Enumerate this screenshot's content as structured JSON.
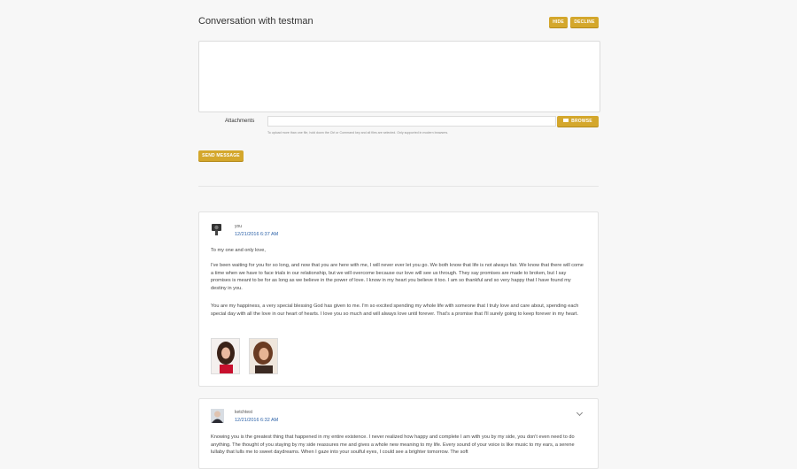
{
  "header": {
    "title": "Conversation with testman",
    "hide_label": "HIDE",
    "decline_label": "DECLINE"
  },
  "compose": {
    "message_value": "",
    "attachments_label": "Attachments",
    "browse_label": "BROWSE",
    "hint": "To upload more than one file, hold down the Ctrl or Command key and all files are selected. Only supported in modern browsers.",
    "send_label": "SEND MESSAGE"
  },
  "messages": [
    {
      "author": "you",
      "time": "12/21/2016 6:37 AM",
      "paragraphs": [
        "To my one and only love,",
        "I've been waiting for you for so long, and now that you are here with me, I will never ever let you go. We both know that life is not always fair. We know that there will come a time when we have to face trials in our relationship, but we will overcome because our love will see us through. They say promises are made to broken, but I say promises is meant to be for as long as we believe in the power of love.   I know in my heart you believe it too. I am so thankful and so very happy that I have found my destiny in you.",
        "You are my happiness, a very special blessing God has given to me. I'm so excited spending my whole life with someone that I truly love and care about, spending each special day with all the love in our heart of hearts. I love you so much and will always love until forever. That's a promise that I'll surely going to keep forever in my heart."
      ]
    },
    {
      "author": "ketchtest",
      "time": "12/21/2016 6:32 AM",
      "paragraphs": [
        "Knowing you is the greatest thing that happened in my entire existence. I never realized how happy and complete I am with you by my side, you don't even need to do anything. The thought of you staying by my side reassures me and gives a whole new meaning to my life. Every sound of your voice is like music to my ears, a serene lullaby that lulls me to sweet daydreams. When I gaze into your soulful eyes, I could see a brighter tomorrow. The soft"
      ]
    }
  ],
  "colors": {
    "accent": "#d4a72c",
    "link": "#2c62a8"
  }
}
